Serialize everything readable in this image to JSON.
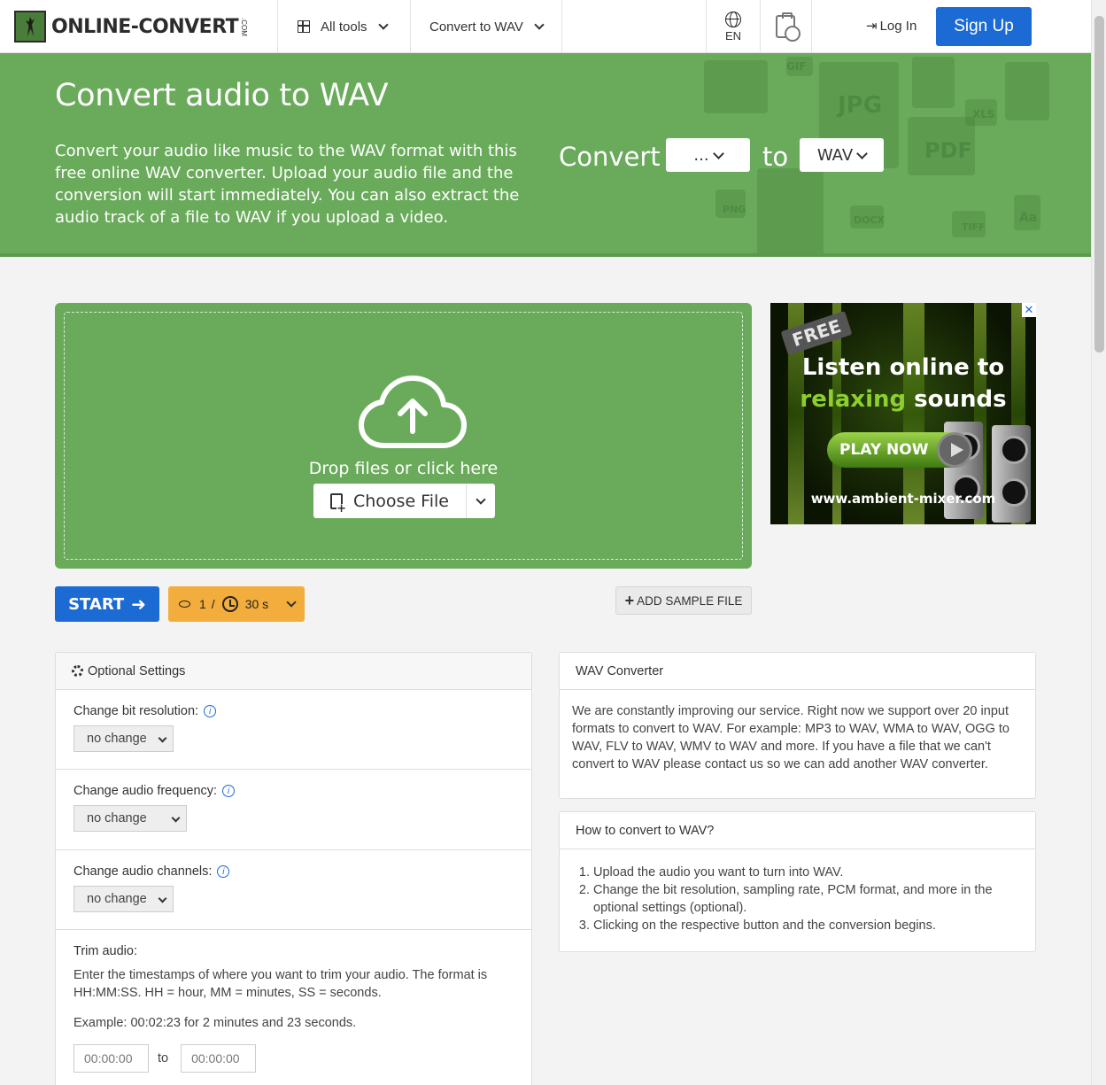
{
  "header": {
    "logo_text": "ONLINE-CONVERT",
    "logo_suffix": ".COM",
    "all_tools": "All tools",
    "convert_menu": "Convert to WAV",
    "language": "EN",
    "login": "Log In",
    "signup": "Sign Up"
  },
  "hero": {
    "title": "Convert audio to WAV",
    "description": "Convert your audio like music to the WAV format with this free online WAV converter. Upload your audio file and the conversion will start immediately. You can also extract the audio track of a file to WAV if you upload a video.",
    "convert_label": "Convert",
    "from_value": "...",
    "to_label": "to",
    "to_value": "WAV",
    "deco_labels": [
      "GIF",
      "JPG",
      "XLS",
      "PDF",
      "PNG",
      "DOCX",
      "TIFF",
      "Aa"
    ]
  },
  "upload": {
    "drop_text": "Drop files or click here",
    "choose_file": "Choose File"
  },
  "actions": {
    "start": "START",
    "credits_count": "1",
    "credits_sep": "/",
    "time": "30 s",
    "add_sample": "ADD SAMPLE FILE"
  },
  "ad": {
    "close": "✕",
    "free": "FREE",
    "line1": "Listen online to",
    "line2_green": "relaxing",
    "line2_rest": " sounds",
    "play": "PLAY NOW",
    "url": "www.ambient-mixer.com"
  },
  "settings": {
    "title": "Optional Settings",
    "bit_label": "Change bit resolution:",
    "bit_value": "no change",
    "freq_label": "Change audio frequency:",
    "freq_value": "no change",
    "channels_label": "Change audio channels:",
    "channels_value": "no change",
    "trim_label": "Trim audio:",
    "trim_desc": "Enter the timestamps of where you want to trim your audio. The format is HH:MM:SS. HH = hour, MM = minutes, SS = seconds.",
    "trim_example": "Example: 00:02:23 for 2 minutes and 23 seconds.",
    "trim_from_placeholder": "00:00:00",
    "trim_to": "to",
    "trim_to_placeholder": "00:00:00"
  },
  "info_panel": {
    "title": "WAV Converter",
    "body": "We are constantly improving our service. Right now we support over 20 input formats to convert to WAV. For example: MP3 to WAV, WMA to WAV, OGG to WAV, FLV to WAV, WMV to WAV and more. If you have a file that we can't convert to WAV please contact us so we can add another WAV converter."
  },
  "howto_panel": {
    "title": "How to convert to WAV?",
    "steps": [
      "Upload the audio you want to turn into WAV.",
      "Change the bit resolution, sampling rate, PCM format, and more in the optional settings (optional).",
      "Clicking on the respective button and the conversion begins."
    ]
  }
}
